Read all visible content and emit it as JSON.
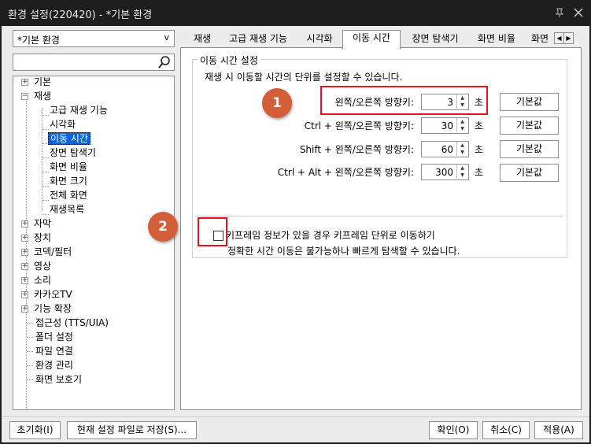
{
  "window": {
    "title": "환경 설정(220420) - *기본 환경",
    "pin_icon": "pin-icon",
    "close_icon": "close-icon"
  },
  "sidebar": {
    "preset_value": "*기본 환경",
    "preset_arrow": "v",
    "search_placeholder": "",
    "tree": [
      {
        "label": "기본",
        "expander": "+"
      },
      {
        "label": "재생",
        "expander": "−"
      },
      {
        "label": "고급 재생 기능"
      },
      {
        "label": "시각화"
      },
      {
        "label": "이동 시간",
        "selected": true
      },
      {
        "label": "장면 탐색기"
      },
      {
        "label": "화면 비율"
      },
      {
        "label": "화면 크기"
      },
      {
        "label": "전체 화면"
      },
      {
        "label": "재생목록"
      },
      {
        "label": "자막",
        "expander": "+"
      },
      {
        "label": "장치",
        "expander": "+"
      },
      {
        "label": "코덱/필터",
        "expander": "+"
      },
      {
        "label": "영상",
        "expander": "+"
      },
      {
        "label": "소리",
        "expander": "+"
      },
      {
        "label": "카카오TV",
        "expander": "+"
      },
      {
        "label": "기능 확장",
        "expander": "+"
      },
      {
        "label": "접근성 (TTS/UIA)"
      },
      {
        "label": "폴더 설정"
      },
      {
        "label": "파일 연결"
      },
      {
        "label": "환경 관리"
      },
      {
        "label": "화면 보호기"
      }
    ]
  },
  "tabs": [
    "재생",
    "고급 재생 기능",
    "시각화",
    "이동 시간",
    "장면 탐색기",
    "화면 비율",
    "화면"
  ],
  "tab_scroll": {
    "left": "◀",
    "right": "▶"
  },
  "panel": {
    "group_title": "이동 시간 설정",
    "description": "재생 시 이동할 시간의 단위를 설정할 수 있습니다.",
    "rows": [
      {
        "label": "왼쪽/오른쪽 방향키:",
        "value": "3",
        "unit": "초",
        "button": "기본값"
      },
      {
        "label": "Ctrl + 왼쪽/오른쪽 방향키:",
        "value": "30",
        "unit": "초",
        "button": "기본값"
      },
      {
        "label": "Shift + 왼쪽/오른쪽 방향키:",
        "value": "60",
        "unit": "초",
        "button": "기본값"
      },
      {
        "label": "Ctrl + Alt + 왼쪽/오른쪽 방향키:",
        "value": "300",
        "unit": "초",
        "button": "기본값"
      }
    ],
    "keyframe_checkbox_label": "키프레임 정보가 있을 경우 키프레임 단위로 이동하기",
    "keyframe_checked": false,
    "keyframe_note": "정확한 시간 이동은 불가능하나 빠르게 탐색할 수 있습니다."
  },
  "annotations": {
    "badge1": "1",
    "badge2": "2",
    "badge_color": "#d35f3a",
    "box_color": "#e2141e"
  },
  "footer": {
    "reset": "초기화(I)",
    "save_file": "현재 설정 파일로 저장(S)...",
    "ok": "확인(O)",
    "cancel": "취소(C)",
    "apply": "적용(A)"
  }
}
